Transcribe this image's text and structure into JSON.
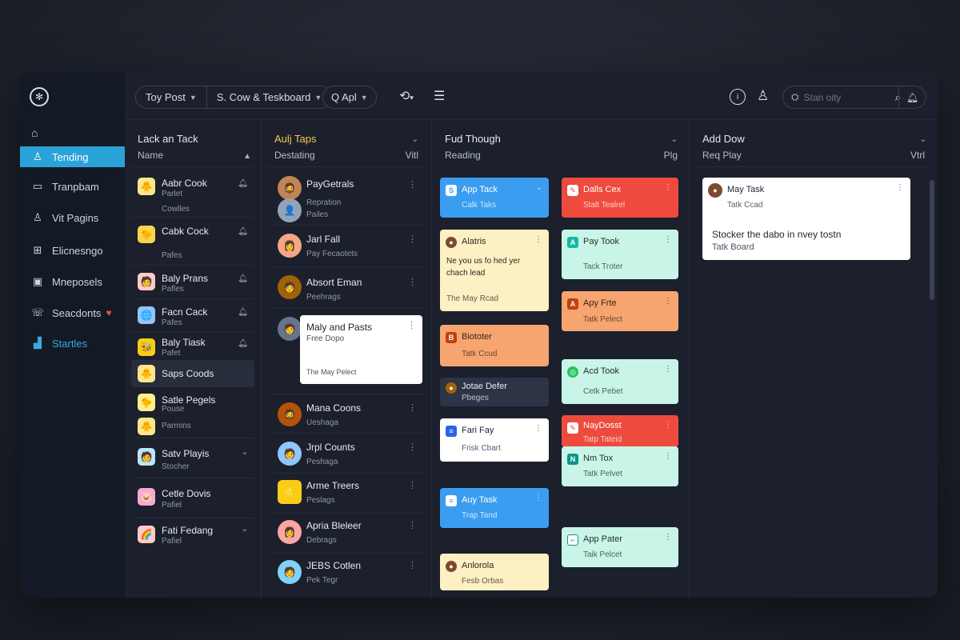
{
  "sidebar": {
    "items": [
      {
        "label": "Tending",
        "icon": "user-icon",
        "glyph": "♙"
      },
      {
        "label": "Tranpbam",
        "icon": "screen-icon",
        "glyph": "▭"
      },
      {
        "label": "Vit Pagins",
        "icon": "user-outline-icon",
        "glyph": "♙"
      },
      {
        "label": "Elicnesngo",
        "icon": "grid-icon",
        "glyph": "⊞"
      },
      {
        "label": "Mneposels",
        "icon": "image-icon",
        "glyph": "▣"
      },
      {
        "label": "Seacdonts",
        "icon": "chat-icon",
        "glyph": "☏"
      },
      {
        "label": "Startles",
        "icon": "chart-icon",
        "glyph": "▟"
      }
    ]
  },
  "topbar": {
    "filter1": "Toy Post",
    "filter2": "S. Cow & Teskboard",
    "search_chip": "Q Apl",
    "search_placeholder": "Stan oity"
  },
  "columns": [
    {
      "title": "Lack an Tack",
      "sub": "Name",
      "right": ""
    },
    {
      "title": "Aulj Taps",
      "sub": "Destating",
      "right": "Vitl"
    },
    {
      "title": "Fud Though",
      "sub": "Reading",
      "right": "Plg"
    },
    {
      "title": "Add Dow",
      "sub": "Req Play",
      "right": "Vtrl"
    }
  ],
  "list1": [
    {
      "name": "Aabr Cook",
      "sub": "Parlet",
      "sub2": "Cowlles"
    },
    {
      "name": "Cabk Cock",
      "sub": "",
      "sub2": "Pafes"
    },
    {
      "name": "Baly Prans",
      "sub": "Pafles"
    },
    {
      "name": "Facn Cack",
      "sub": "Pafes"
    },
    {
      "name": "Baly Tiask",
      "sub": "Pafet"
    },
    {
      "name": "Saps Coods",
      "sub": ""
    },
    {
      "name": "Satle Pegels",
      "sub": "Pouse",
      "sub2": "Parmins"
    },
    {
      "name": "Satv Playis",
      "sub": "Stocher"
    },
    {
      "name": "Cetle Dovis",
      "sub": "Pafiel"
    },
    {
      "name": "Fati Fedang",
      "sub": "Pafiel"
    }
  ],
  "list2": [
    {
      "name": "PayGetrals",
      "sub": "Repration",
      "sub2": "Pailes"
    },
    {
      "name": "Jarl Fall",
      "sub": "Pay Fecaotets"
    },
    {
      "name": "Absort Eman",
      "sub": "Peehrags"
    },
    {
      "name": "Maly and Pasts",
      "sub": "Free Dopo",
      "sub2": "The May Pelect"
    },
    {
      "name": "Mana Coons",
      "sub": "Ueshaga"
    },
    {
      "name": "Jrpl Counts",
      "sub": "Peshaga"
    },
    {
      "name": "Arme Treers",
      "sub": "Peslags"
    },
    {
      "name": "Apria Bleleer",
      "sub": "Debrags"
    },
    {
      "name": "JEBS Cotlen",
      "sub": "Pek Tegr"
    }
  ],
  "cards_a": [
    {
      "title": "App Tack",
      "sub": "Calk Taks"
    },
    {
      "title": "Alatris",
      "body": "Ne you us fo hed yer chach lead",
      "sub": "The May Rcad"
    },
    {
      "title": "Biototer",
      "sub": "Tatk Ccud"
    },
    {
      "title": "Jotae Defer",
      "sub": "Pbeges"
    },
    {
      "title": "Fari Fay",
      "sub": "Frisk Cbart"
    },
    {
      "title": "Auy Task",
      "sub": "Trap Tand"
    },
    {
      "title": "Anlorola",
      "sub": "Fesb Orbas"
    }
  ],
  "cards_b": [
    {
      "title": "Dalls Cex",
      "sub": "Stalt Tealrel"
    },
    {
      "title": "Pay Took",
      "sub": "Tack Troter"
    },
    {
      "title": "Apy Frte",
      "sub": "Tatk Pelect"
    },
    {
      "title": "Acd Took",
      "sub": "Cetk Pebet"
    },
    {
      "title": "NayDosst",
      "sub": "Tatp Tateid"
    },
    {
      "title": "Nm Tox",
      "sub": "Tatk Pelvet"
    },
    {
      "title": "App Pater",
      "sub": "Taik Pelcet"
    }
  ],
  "card_c": {
    "title": "May Task",
    "sub": "Tatk Ccad",
    "body": "Stocker the dabo in nvey tostn",
    "sub2": "Tatk Board"
  }
}
